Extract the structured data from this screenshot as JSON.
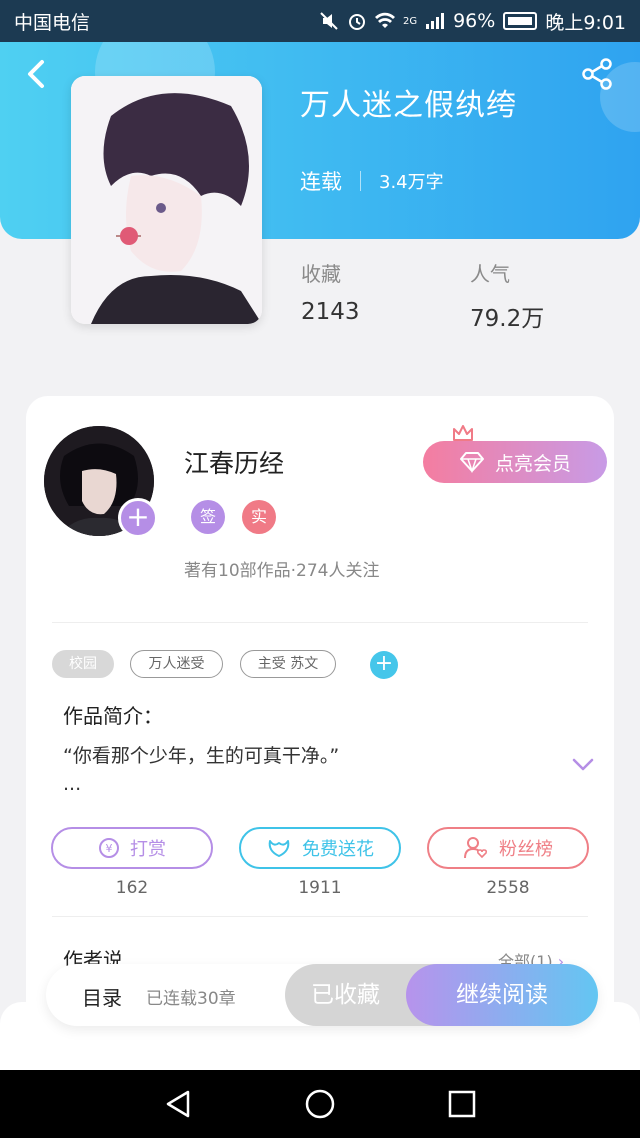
{
  "status_bar": {
    "carrier": "中国电信",
    "signal_type": "2G",
    "battery": "96%",
    "time": "晚上9:01"
  },
  "book": {
    "title": "万人迷之假纨绔",
    "status": "连载",
    "word_count": "3.4万字",
    "stats": [
      {
        "label": "收藏",
        "value": "2143"
      },
      {
        "label": "人气",
        "value": "79.2万"
      }
    ]
  },
  "author": {
    "name": "江春历经",
    "badges": [
      {
        "text": "签",
        "color": "#b58ee6"
      },
      {
        "text": "实",
        "color": "#f07a86"
      }
    ],
    "summary": "著有10部作品·274人关注",
    "vip_button": "点亮会员"
  },
  "tags": [
    "校园",
    "万人迷受",
    "主受 苏文"
  ],
  "intro": {
    "heading": "作品简介：",
    "text": "“你看那个少年，生的可真干净。”",
    "ellipsis": "..."
  },
  "actions": [
    {
      "label": "打赏",
      "count": "162",
      "color": "#b58ee6"
    },
    {
      "label": "免费送花",
      "count": "1911",
      "color": "#3fc3e8"
    },
    {
      "label": "粉丝榜",
      "count": "2558",
      "color": "#ef7f86"
    }
  ],
  "author_says": {
    "heading": "作者说",
    "all_link": "全部(1)"
  },
  "bottom_bar": {
    "toc": "目录",
    "chapters": "已连载30章",
    "collected": "已收藏",
    "continue": "继续阅读"
  },
  "colors": {
    "header_start": "#4fd0f2",
    "header_end": "#2fa3f0",
    "accent_purple": "#b58ee6",
    "accent_cyan": "#3fc3e8",
    "accent_red": "#ef7f86"
  }
}
